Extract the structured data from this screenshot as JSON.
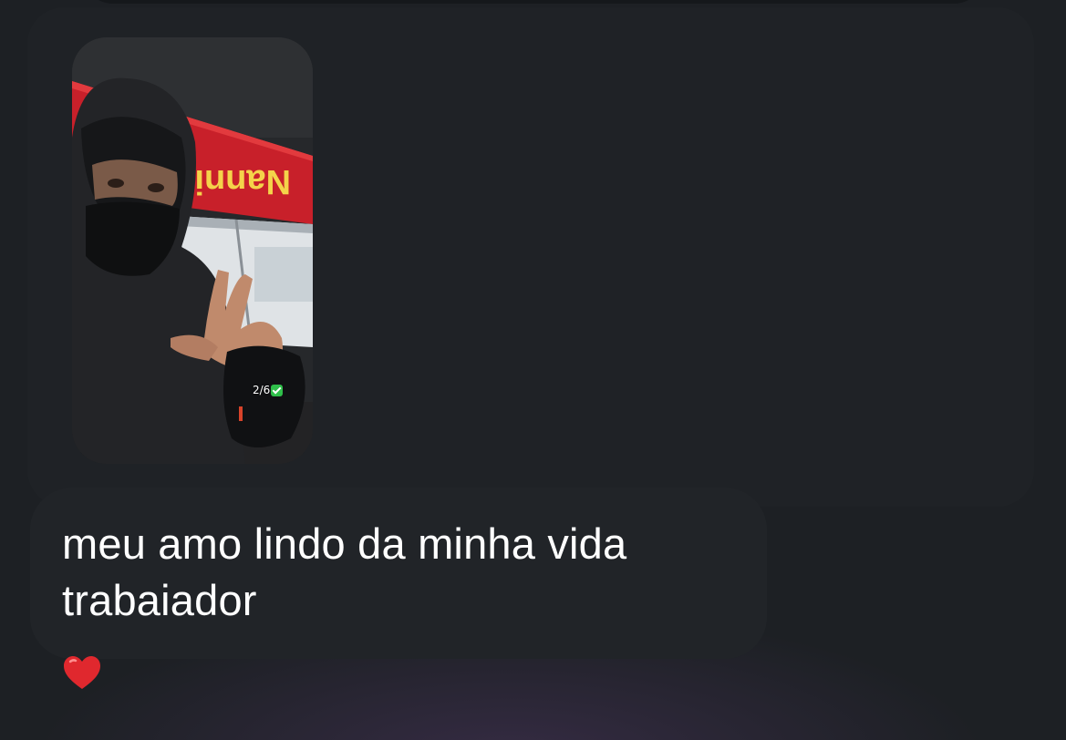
{
  "story": {
    "counter": "2/6",
    "counter_icon": "check-mark-icon",
    "storefront_sign": "Nanni"
  },
  "message": {
    "line1": "meu amo lindo da minha vida",
    "line2": "trabaiador"
  },
  "reaction": {
    "icon": "red-heart-icon",
    "color": "#e0282e"
  },
  "colors": {
    "background": "#1d2024",
    "bubble": "#212428",
    "text": "#ffffff"
  }
}
